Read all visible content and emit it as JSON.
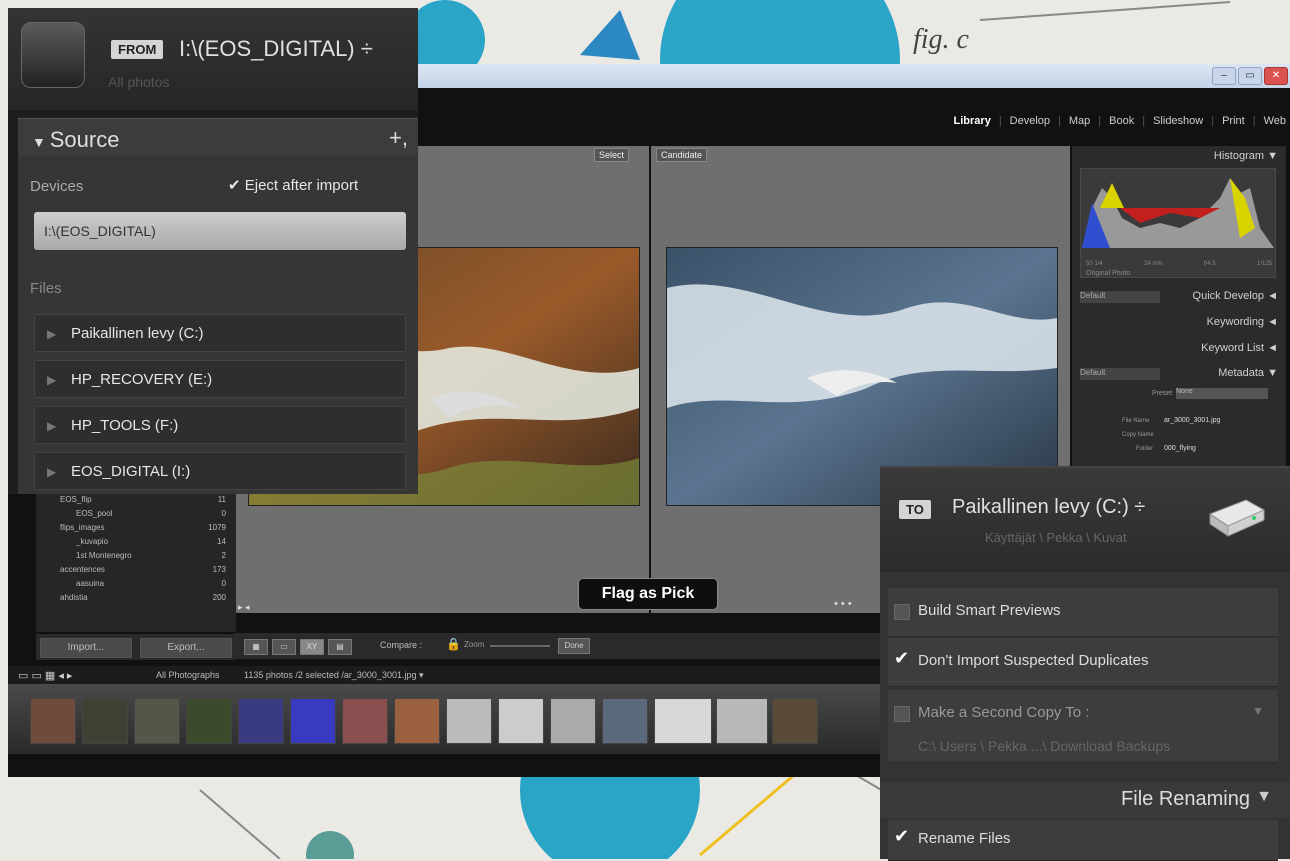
{
  "background": {
    "annotation": "fig. c"
  },
  "window": {
    "buttons": [
      "–",
      "▭",
      "✕"
    ]
  },
  "modules": [
    "Library",
    "Develop",
    "Map",
    "Book",
    "Slideshow",
    "Print",
    "Web"
  ],
  "compare": {
    "select_label": "Select",
    "candidate_label": "Candidate"
  },
  "right_panel": {
    "histogram": "Histogram ▼",
    "hist_readout": [
      "50 1/4",
      "24 mm",
      "f/4.5",
      "1/125"
    ],
    "original_photo": "Original Photo",
    "quick_develop_preset": "Default",
    "quick_develop": "Quick Develop ◄",
    "keywording": "Keywording ◄",
    "keyword_list": "Keyword List ◄",
    "metadata_preset": "Default",
    "metadata": "Metadata ▼",
    "preset_label": "Preset",
    "preset_value": "None",
    "file_name_label": "File Name",
    "file_name": "ar_3000_3001.jpg",
    "copy_name_label": "Copy Name",
    "folder_label": "Folder",
    "folder": "000_flying"
  },
  "folders": [
    {
      "name": "EOS_flip",
      "count": "11"
    },
    {
      "name": "EOS_pool",
      "count": "0"
    },
    {
      "name": "flips_images",
      "count": "1079"
    },
    {
      "name": "_kuvapio",
      "count": "14"
    },
    {
      "name": "1st Montenegro",
      "count": "2"
    },
    {
      "name": "accentences",
      "count": "173"
    },
    {
      "name": "aasuina",
      "count": "0"
    },
    {
      "name": "ahdistia",
      "count": "200"
    }
  ],
  "left_buttons": {
    "import": "Import...",
    "export": "Export..."
  },
  "toolbar": {
    "compare_label": "Compare :",
    "zoom_label": "Zoom",
    "done_label": "Done"
  },
  "tooltip": "Flag as Pick",
  "filmstrip": {
    "source": "All Photographs",
    "info": "1135 photos /2 selected /ar_3000_3001.jpg ▾"
  },
  "from": {
    "badge": "FROM",
    "path": "I:\\(EOS_DIGITAL) ÷",
    "subtitle": "All photos",
    "source_title": "Source",
    "source_plus": "+,",
    "devices_label": "Devices",
    "eject_label": "Eject after import",
    "device_selected": "I:\\(EOS_DIGITAL)",
    "files_label": "Files",
    "files": [
      "Paikallinen levy (C:)",
      "HP_RECOVERY (E:)",
      "HP_TOOLS (F:)",
      "EOS_DIGITAL (I:)"
    ]
  },
  "to": {
    "badge": "TO",
    "path": "Paikallinen levy (C:) ÷",
    "subtitle": "Käyttäjät \\ Pekka \\ Kuvat",
    "options": {
      "smart_previews": "Build Smart Previews",
      "no_duplicates": "Don't Import Suspected Duplicates",
      "second_copy": "Make a Second Copy To :",
      "second_copy_path": "C:\\ Users \\ Pekka ...\\ Download Backups"
    },
    "renaming_title": "File Renaming",
    "rename_files": "Rename Files"
  }
}
